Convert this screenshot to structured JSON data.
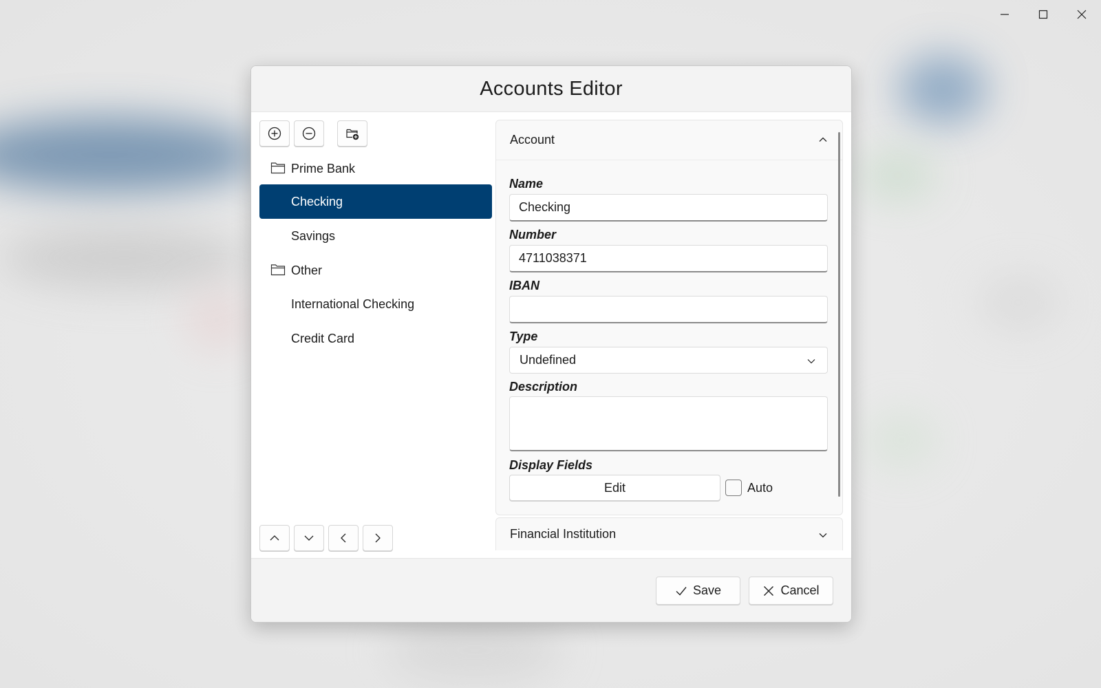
{
  "dialog": {
    "title": "Accounts Editor"
  },
  "window_controls": [
    "minimize-icon",
    "maximize-icon",
    "close-icon"
  ],
  "toolbar": {
    "add_icon": "plus-circle-icon",
    "remove_icon": "minus-circle-icon",
    "add_folder_icon": "folder-add-icon"
  },
  "tree": {
    "items": [
      {
        "label": "Prime Bank",
        "type": "folder"
      },
      {
        "label": "Checking",
        "type": "account",
        "selected": true
      },
      {
        "label": "Savings",
        "type": "account"
      },
      {
        "label": "Other",
        "type": "folder"
      },
      {
        "label": "International Checking",
        "type": "account"
      },
      {
        "label": "Credit Card",
        "type": "account"
      }
    ]
  },
  "account_panel": {
    "header": "Account",
    "name_label": "Name",
    "name_value": "Checking",
    "number_label": "Number",
    "number_value": "4711038371",
    "iban_label": "IBAN",
    "iban_value": "",
    "type_label": "Type",
    "type_value": "Undefined",
    "description_label": "Description",
    "description_value": "",
    "display_fields_label": "Display Fields",
    "edit_button": "Edit",
    "auto_label": "Auto",
    "auto_checked": false
  },
  "financial_panel": {
    "header": "Financial Institution"
  },
  "nav_buttons": [
    "chevron-up-icon",
    "chevron-down-icon",
    "chevron-left-icon",
    "chevron-right-icon"
  ],
  "footer": {
    "save": "Save",
    "cancel": "Cancel"
  },
  "colors": {
    "selection": "#003f72",
    "dialog_bg": "#ffffff",
    "header_bg": "#f3f3f3"
  }
}
